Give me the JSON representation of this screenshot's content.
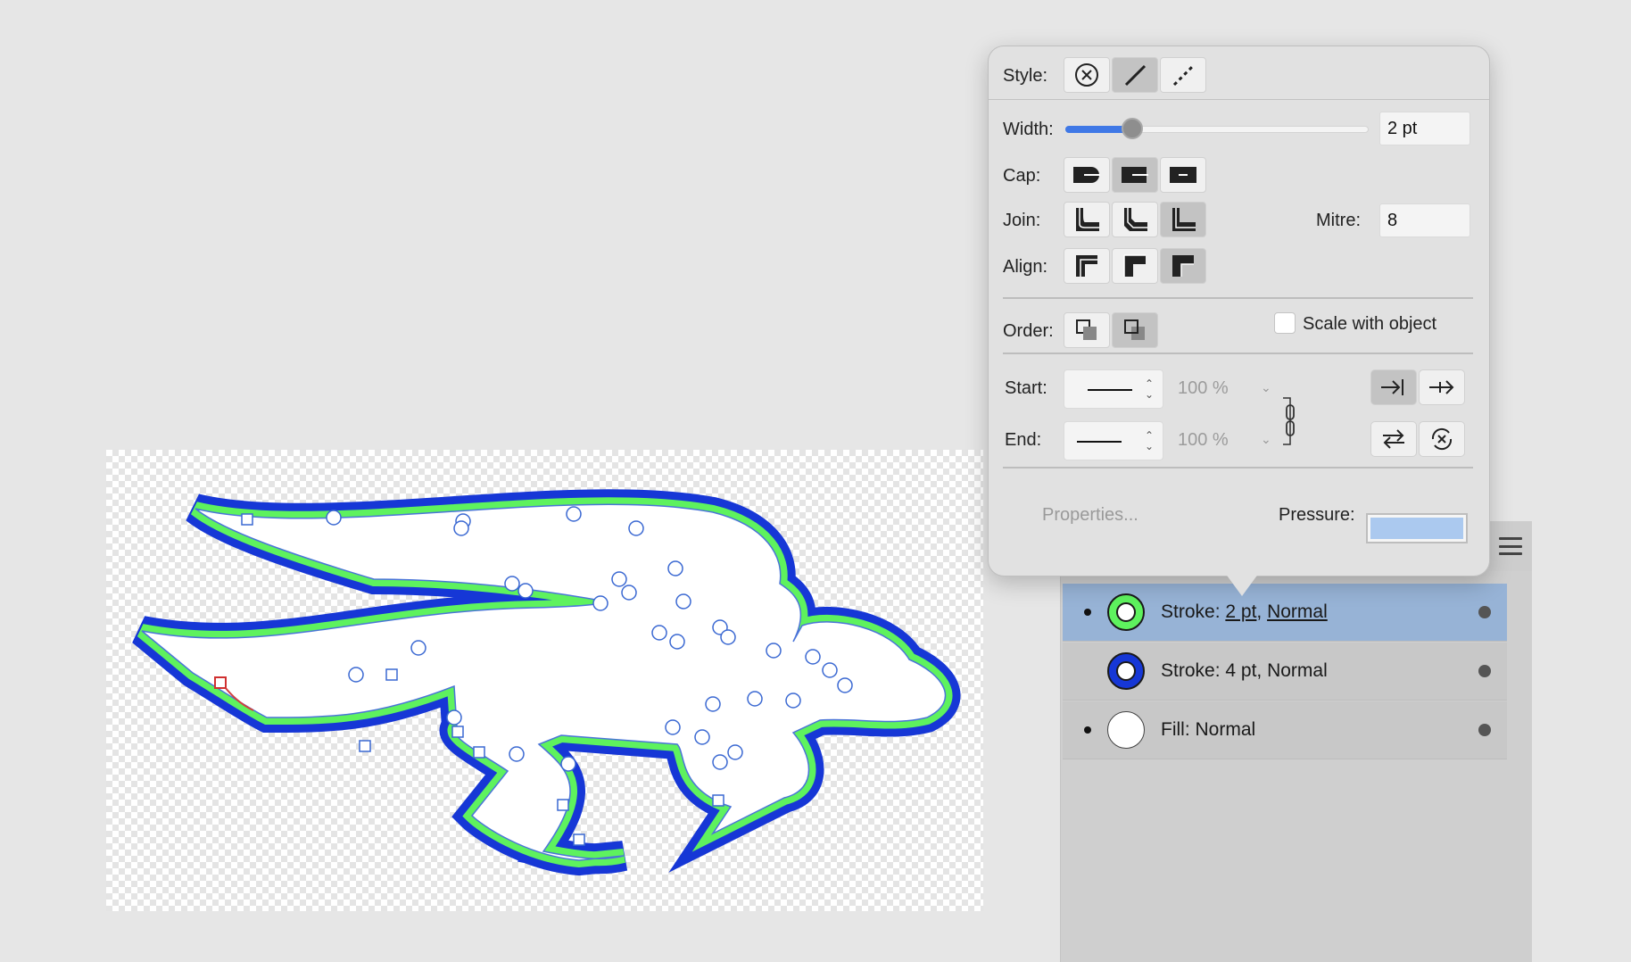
{
  "colors": {
    "outer_stroke": "#1637d6",
    "inner_stroke": "#5ef25e",
    "fill": "#ffffff",
    "selection_row": "#97b3d6",
    "slider_accent": "#3f78e6",
    "pressure_swatch": "#abc9ef"
  },
  "popover": {
    "style_label": "Style:",
    "style_options": [
      "none-icon",
      "solid-line-icon",
      "dashed-line-icon"
    ],
    "style_selected": "solid-line-icon",
    "width_label": "Width:",
    "width_value": "2 pt",
    "width_fraction": 0.22,
    "cap_label": "Cap:",
    "cap_options": [
      "butt-cap-icon",
      "round-cap-icon",
      "square-cap-icon"
    ],
    "join_label": "Join:",
    "join_options": [
      "mitre-join-icon",
      "round-join-icon",
      "bevel-join-icon"
    ],
    "mitre_label": "Mitre:",
    "mitre_value": "8",
    "align_label": "Align:",
    "align_options": [
      "align-center-icon",
      "align-inside-icon",
      "align-outside-icon"
    ],
    "order_label": "Order:",
    "order_options": [
      "stroke-front-icon",
      "stroke-back-icon"
    ],
    "scale_label": "Scale with object",
    "scale_checked": false,
    "start_label": "Start:",
    "start_pct": "100 %",
    "end_label": "End:",
    "end_pct": "100 %",
    "properties_label": "Properties...",
    "pressure_label": "Pressure:"
  },
  "layers": [
    {
      "label_prefix": "Stroke: ",
      "width": "2 pt",
      "sep": ", ",
      "blend": "Normal",
      "visible": true,
      "selected": true,
      "swatch": "#5ef25e"
    },
    {
      "label_prefix": "Stroke: ",
      "width": "4 pt",
      "sep": ", ",
      "blend": "Normal",
      "visible": false,
      "selected": false,
      "swatch": "#1637d6"
    },
    {
      "label": "Fill: Normal",
      "visible": true,
      "selected": false,
      "swatch": "#ffffff"
    }
  ]
}
